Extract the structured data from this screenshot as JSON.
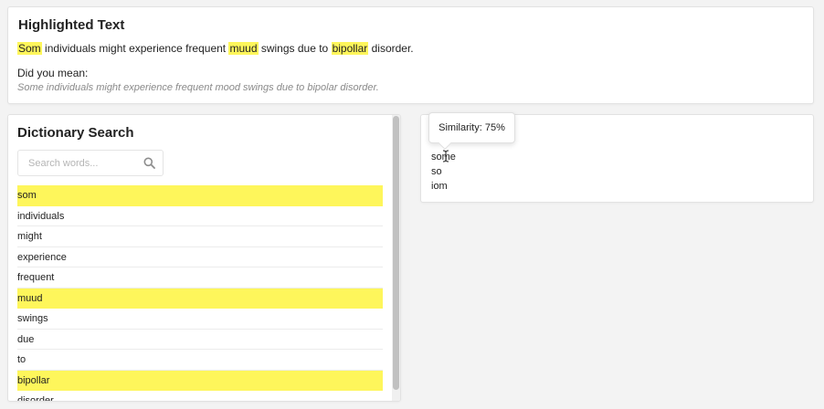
{
  "highlighted": {
    "title": "Highlighted Text",
    "segments": [
      {
        "text": "Som",
        "highlighted": true
      },
      {
        "text": " individuals might experience frequent ",
        "highlighted": false
      },
      {
        "text": "muud",
        "highlighted": true
      },
      {
        "text": " swings due to ",
        "highlighted": false
      },
      {
        "text": "bipollar",
        "highlighted": true
      },
      {
        "text": " disorder.",
        "highlighted": false
      }
    ],
    "did_you_mean_label": "Did you mean:",
    "suggestion": "Some individuals might experience frequent mood swings due to bipolar disorder."
  },
  "dictionary": {
    "title": "Dictionary Search",
    "search_placeholder": "Search words...",
    "search_value": "",
    "words": [
      {
        "label": "som",
        "highlighted": true
      },
      {
        "label": "individuals",
        "highlighted": false
      },
      {
        "label": "might",
        "highlighted": false
      },
      {
        "label": "experience",
        "highlighted": false
      },
      {
        "label": "frequent",
        "highlighted": false
      },
      {
        "label": "muud",
        "highlighted": true
      },
      {
        "label": "swings",
        "highlighted": false
      },
      {
        "label": "due",
        "highlighted": false
      },
      {
        "label": "to",
        "highlighted": false
      },
      {
        "label": "bipollar",
        "highlighted": true
      },
      {
        "label": "disorder",
        "highlighted": false
      }
    ]
  },
  "suggestions": {
    "items": [
      "some",
      "so",
      "iom"
    ]
  },
  "tooltip": {
    "text": "Similarity: 75%"
  },
  "colors": {
    "highlight": "#fef65b",
    "muted_text": "#8a8a8a"
  },
  "icons": {
    "search": "search-icon",
    "cursor": "text-cursor-icon"
  }
}
